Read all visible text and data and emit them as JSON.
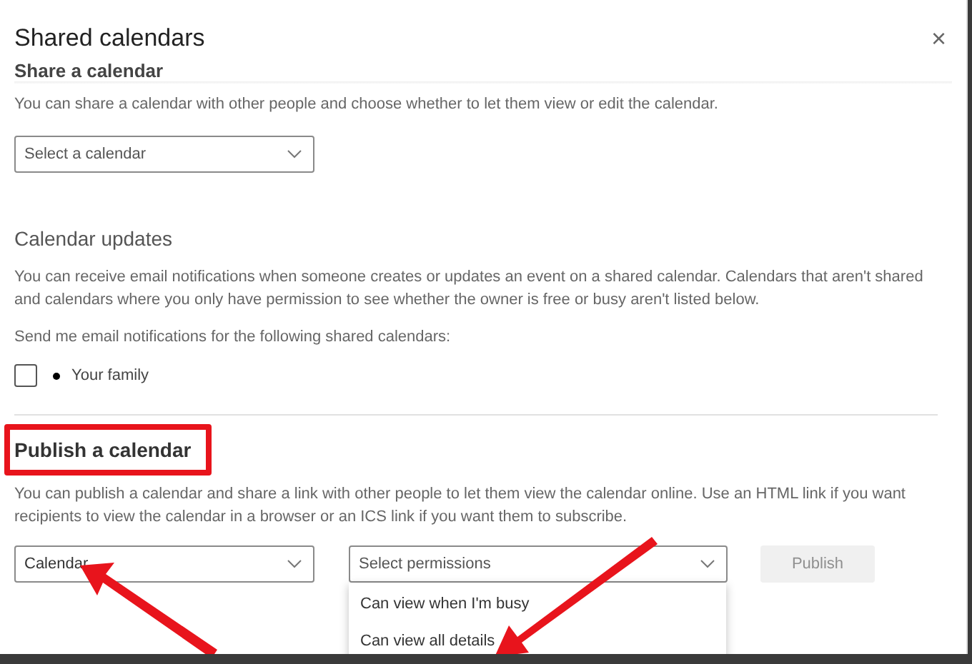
{
  "dialog": {
    "title": "Shared calendars",
    "close_icon": "×"
  },
  "share": {
    "heading": "Share a calendar",
    "text": "You can share a calendar with other people and choose whether to let them view or edit the calendar.",
    "select": {
      "placeholder": "Select a calendar"
    }
  },
  "updates": {
    "heading": "Calendar updates",
    "text": "You can receive email notifications when someone creates or updates an event on a shared calendar. Calendars that aren't shared and calendars where you only have permission to see whether the owner is free or busy aren't listed below.",
    "prompt": "Send me email notifications for the following shared calendars:",
    "calendars": [
      {
        "name": "Your family",
        "checked": false,
        "color": "#000000"
      }
    ]
  },
  "publish": {
    "heading": "Publish a calendar",
    "highlighted": true,
    "arrows_shown": true,
    "text": "You can publish a calendar and share a link with other people to let them view the calendar online. Use an HTML link if you want recipients to view the calendar in a browser or an ICS link if you want them to subscribe.",
    "calendar_select": {
      "value": "Calendar"
    },
    "permission_select": {
      "placeholder": "Select permissions",
      "expanded": true,
      "options": [
        {
          "label": "Can view when I'm busy",
          "selected": false
        },
        {
          "label": "Can view all details",
          "selected": false
        }
      ]
    },
    "button": {
      "label": "Publish",
      "disabled": true
    }
  }
}
